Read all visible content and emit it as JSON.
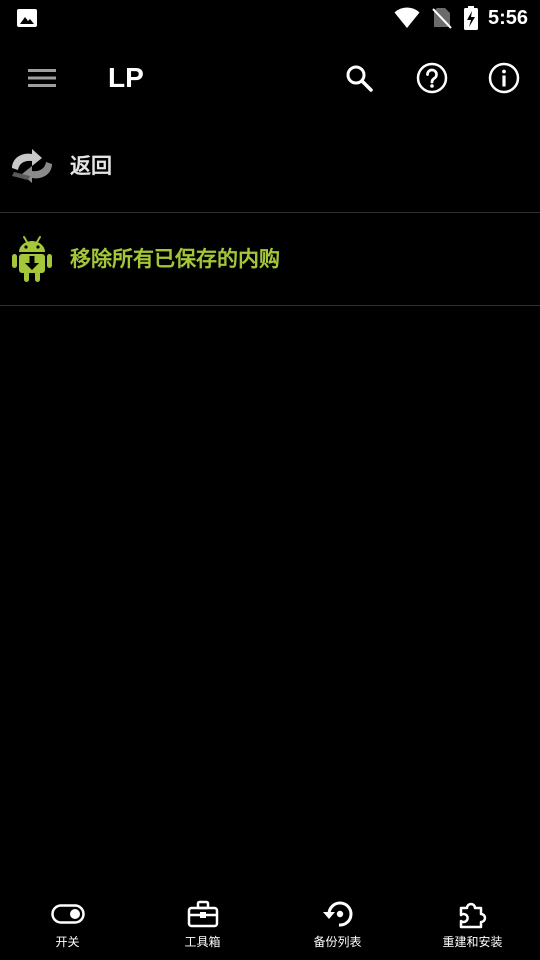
{
  "status_bar": {
    "time": "5:56",
    "icons": [
      "gallery-icon",
      "wifi-icon",
      "no-sim-icon",
      "battery-charging-icon"
    ]
  },
  "app_bar": {
    "title": "LP",
    "icons": [
      "menu-icon",
      "search-icon",
      "help-icon",
      "info-icon"
    ]
  },
  "list": {
    "items": [
      {
        "label": "返回",
        "icon": "back-arrows-icon"
      },
      {
        "label": "移除所有已保存的内购",
        "icon": "android-download-icon"
      }
    ]
  },
  "bottom_nav": {
    "items": [
      {
        "label": "开关",
        "icon": "toggle-icon"
      },
      {
        "label": "工具箱",
        "icon": "toolbox-icon"
      },
      {
        "label": "备份列表",
        "icon": "restore-icon"
      },
      {
        "label": "重建和安装",
        "icon": "puzzle-icon"
      }
    ]
  },
  "colors": {
    "background": "#000000",
    "accent_green": "#a4c639",
    "text": "#ffffff",
    "divider": "#2e2e2e"
  }
}
